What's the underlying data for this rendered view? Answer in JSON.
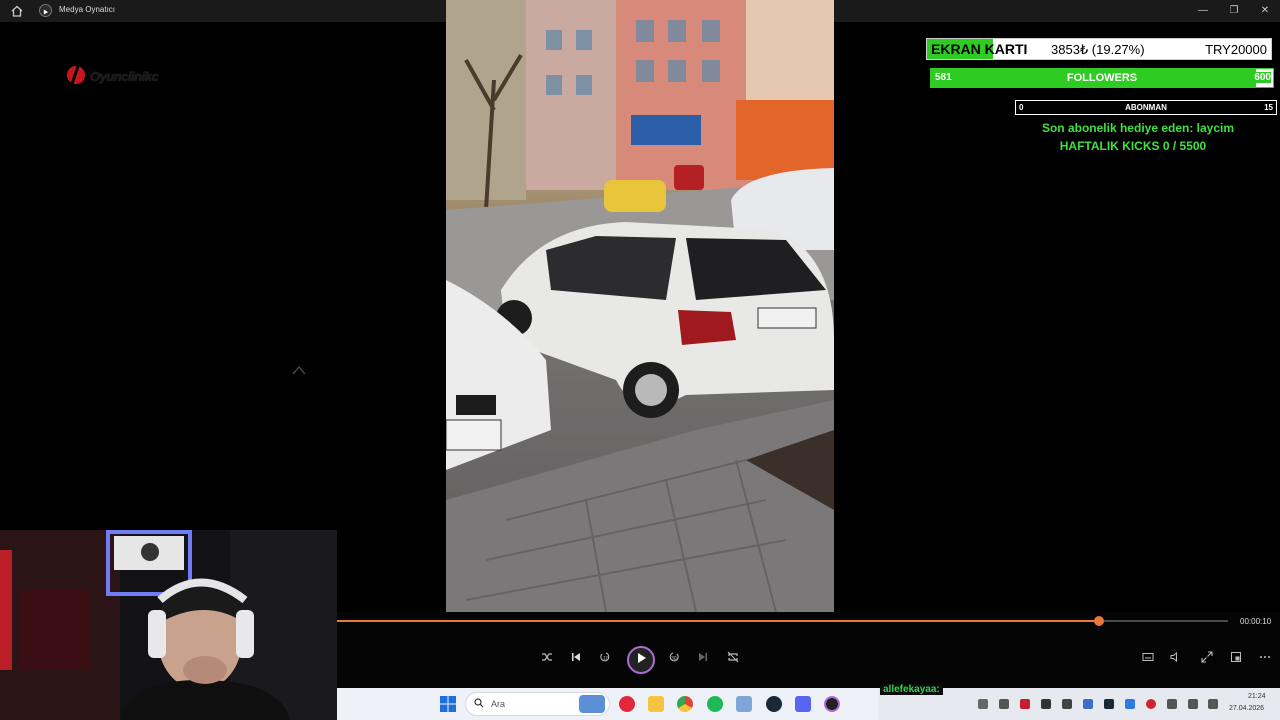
{
  "window": {
    "title": "Medya Oynatıcı",
    "controls": {
      "minimize": "—",
      "maximize": "❐",
      "close": "✕"
    }
  },
  "overlay": {
    "logo_text": "Oyunclinikc",
    "ekran": {
      "label": "EKRAN KARTI",
      "value": "3853₺ (19.27%)",
      "target": "TRY20000",
      "progress": 0.1927
    },
    "followers": {
      "min": "581",
      "label": "FOLLOWERS",
      "max": "600",
      "progress": 0.95
    },
    "abonman": {
      "min": "0",
      "label": "ABONMAN",
      "max": "15",
      "progress": 0
    },
    "gift_text": "Son abonelik hediye eden: laycim",
    "kicks_text": "HAFTALIK KICKS 0 / 5500",
    "colors": {
      "accent_green": "#2ecc22",
      "text_green": "#3fe040"
    }
  },
  "player": {
    "time": "00:00:10",
    "progress": 0.855,
    "accent": "#e8773a",
    "buttons": {
      "shuffle": "shuffle-icon",
      "previous": "previous-icon",
      "rewind": "rewind-10-icon",
      "play": "play-icon",
      "forward": "forward-30-icon",
      "next": "next-icon",
      "repeat": "repeat-off-icon",
      "subtitles": "subtitles-icon",
      "volume": "volume-icon",
      "fullscreen": "fullscreen-icon",
      "miniplayer": "miniplayer-icon",
      "more": "more-icon"
    }
  },
  "taskbar": {
    "search_placeholder": "Ara",
    "chat_user": "allefekayaa:",
    "clock_time": "21:24",
    "clock_date": "27.04.2026",
    "apps": [
      "widgets-icon",
      "media-icon",
      "file-explorer-icon",
      "chrome-icon",
      "spotify-icon",
      "app-icon",
      "steam-icon",
      "discord-icon",
      "media-player-icon"
    ]
  }
}
